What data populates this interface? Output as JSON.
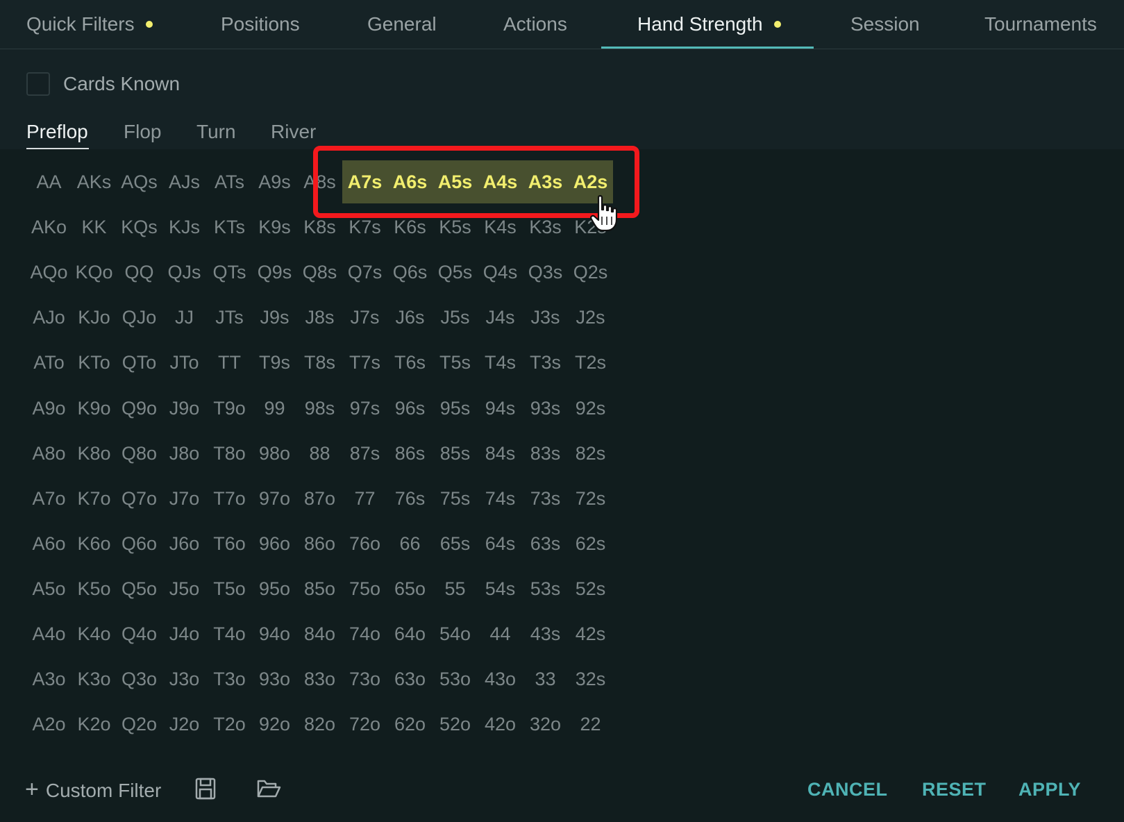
{
  "colors": {
    "background": "#111d1e",
    "accent": "#53b9b8",
    "indicator_dot": "#f2ee6e",
    "selected_bg": "#48502f",
    "selected_text": "#f2ee6e",
    "annotation_red": "#f4191d"
  },
  "nav": {
    "tabs": [
      {
        "label": "Quick Filters",
        "has_dot": true,
        "active": false
      },
      {
        "label": "Positions",
        "has_dot": false,
        "active": false
      },
      {
        "label": "General",
        "has_dot": false,
        "active": false
      },
      {
        "label": "Actions",
        "has_dot": false,
        "active": false
      },
      {
        "label": "Hand Strength",
        "has_dot": true,
        "active": true
      },
      {
        "label": "Session",
        "has_dot": false,
        "active": false
      },
      {
        "label": "Tournaments",
        "has_dot": false,
        "active": false
      }
    ]
  },
  "cards_known": {
    "label": "Cards Known",
    "checked": false
  },
  "streets": {
    "tabs": [
      "Preflop",
      "Flop",
      "Turn",
      "River"
    ],
    "active": "Preflop"
  },
  "hand_grid": {
    "rows": [
      [
        "AA",
        "AKs",
        "AQs",
        "AJs",
        "ATs",
        "A9s",
        "A8s",
        "A7s",
        "A6s",
        "A5s",
        "A4s",
        "A3s",
        "A2s"
      ],
      [
        "AKo",
        "KK",
        "KQs",
        "KJs",
        "KTs",
        "K9s",
        "K8s",
        "K7s",
        "K6s",
        "K5s",
        "K4s",
        "K3s",
        "K2s"
      ],
      [
        "AQo",
        "KQo",
        "QQ",
        "QJs",
        "QTs",
        "Q9s",
        "Q8s",
        "Q7s",
        "Q6s",
        "Q5s",
        "Q4s",
        "Q3s",
        "Q2s"
      ],
      [
        "AJo",
        "KJo",
        "QJo",
        "JJ",
        "JTs",
        "J9s",
        "J8s",
        "J7s",
        "J6s",
        "J5s",
        "J4s",
        "J3s",
        "J2s"
      ],
      [
        "ATo",
        "KTo",
        "QTo",
        "JTo",
        "TT",
        "T9s",
        "T8s",
        "T7s",
        "T6s",
        "T5s",
        "T4s",
        "T3s",
        "T2s"
      ],
      [
        "A9o",
        "K9o",
        "Q9o",
        "J9o",
        "T9o",
        "99",
        "98s",
        "97s",
        "96s",
        "95s",
        "94s",
        "93s",
        "92s"
      ],
      [
        "A8o",
        "K8o",
        "Q8o",
        "J8o",
        "T8o",
        "98o",
        "88",
        "87s",
        "86s",
        "85s",
        "84s",
        "83s",
        "82s"
      ],
      [
        "A7o",
        "K7o",
        "Q7o",
        "J7o",
        "T7o",
        "97o",
        "87o",
        "77",
        "76s",
        "75s",
        "74s",
        "73s",
        "72s"
      ],
      [
        "A6o",
        "K6o",
        "Q6o",
        "J6o",
        "T6o",
        "96o",
        "86o",
        "76o",
        "66",
        "65s",
        "64s",
        "63s",
        "62s"
      ],
      [
        "A5o",
        "K5o",
        "Q5o",
        "J5o",
        "T5o",
        "95o",
        "85o",
        "75o",
        "65o",
        "55",
        "54s",
        "53s",
        "52s"
      ],
      [
        "A4o",
        "K4o",
        "Q4o",
        "J4o",
        "T4o",
        "94o",
        "84o",
        "74o",
        "64o",
        "54o",
        "44",
        "43s",
        "42s"
      ],
      [
        "A3o",
        "K3o",
        "Q3o",
        "J3o",
        "T3o",
        "93o",
        "83o",
        "73o",
        "63o",
        "53o",
        "43o",
        "33",
        "32s"
      ],
      [
        "A2o",
        "K2o",
        "Q2o",
        "J2o",
        "T2o",
        "92o",
        "82o",
        "72o",
        "62o",
        "52o",
        "42o",
        "32o",
        "22"
      ]
    ],
    "selected": [
      "A7s",
      "A6s",
      "A5s",
      "A4s",
      "A3s",
      "A2s"
    ]
  },
  "footer": {
    "custom_filter_label": "Custom Filter",
    "save_icon": "save-icon",
    "open_icon": "folder-open-icon",
    "cancel_label": "CANCEL",
    "reset_label": "RESET",
    "apply_label": "APPLY"
  }
}
